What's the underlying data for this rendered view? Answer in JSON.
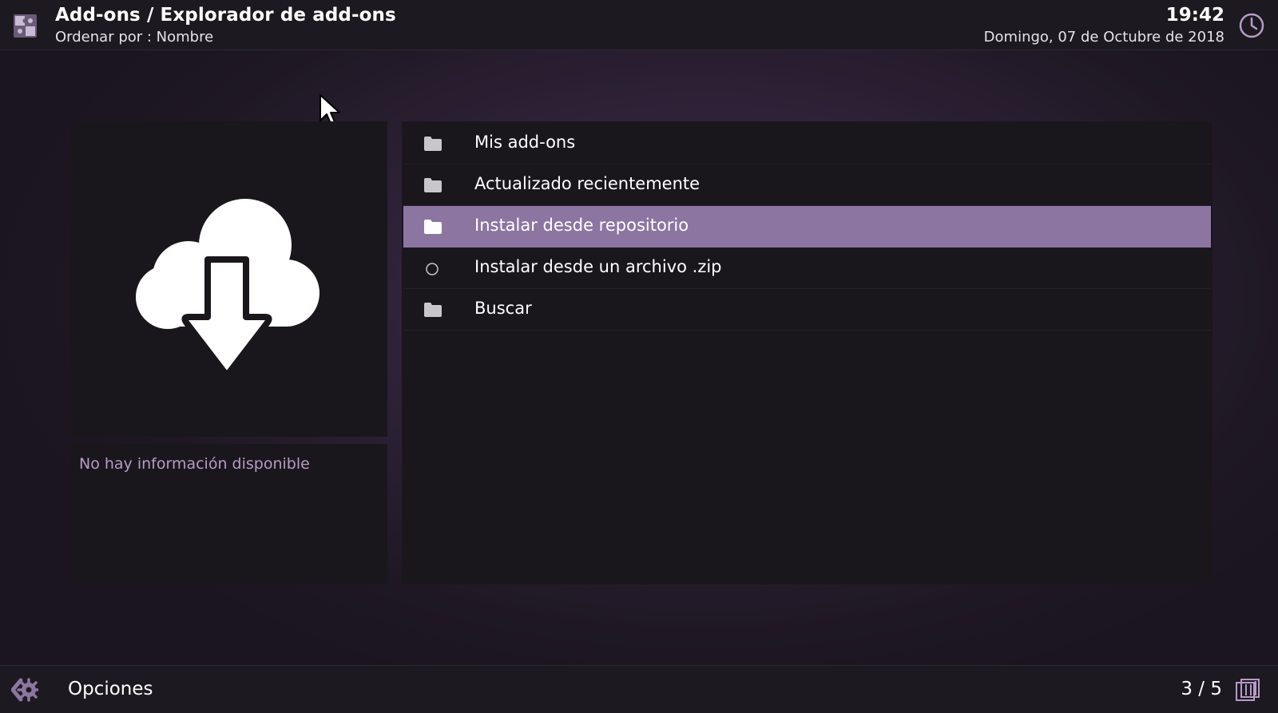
{
  "header": {
    "title": "Add-ons / Explorador de add-ons",
    "sort_label": "Ordenar por : Nombre",
    "time": "19:42",
    "date": "Domingo, 07 de Octubre de 2018",
    "app_icon": "addon-puzzle-icon",
    "clock_icon": "clock-icon"
  },
  "preview": {
    "icon": "cloud-download-icon",
    "info_text": "No hay información disponible"
  },
  "list": {
    "items": [
      {
        "label": "Mis add-ons",
        "icon": "folder-icon",
        "selected": false
      },
      {
        "label": "Actualizado recientemente",
        "icon": "folder-icon",
        "selected": false
      },
      {
        "label": "Instalar desde repositorio",
        "icon": "folder-icon",
        "selected": true
      },
      {
        "label": "Instalar desde un archivo .zip",
        "icon": "circle-icon",
        "selected": false
      },
      {
        "label": "Buscar",
        "icon": "folder-icon",
        "selected": false
      }
    ]
  },
  "footer": {
    "options_label": "Opciones",
    "page_counter": "3 / 5",
    "options_icon": "options-icon",
    "viewtype_icon": "viewtype-icon"
  },
  "colors": {
    "accent": "#8d75a1",
    "info_text": "#b79ac9",
    "panel_bg": "#1a171c",
    "bar_bg": "#1d1920"
  }
}
